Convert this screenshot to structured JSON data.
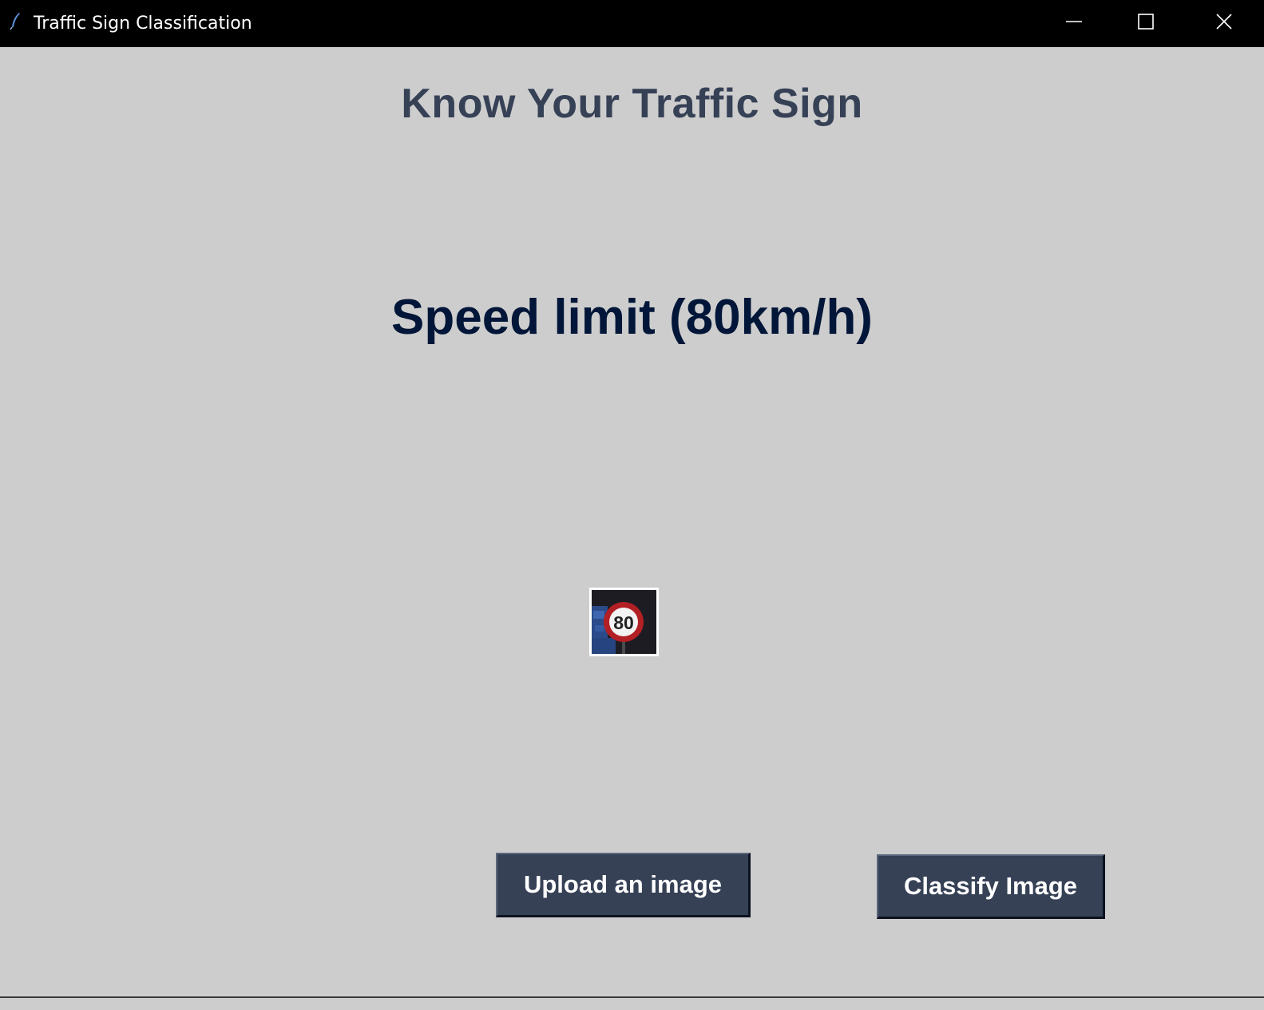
{
  "window": {
    "title": "Traffic Sign Classification",
    "icon": "feather-icon",
    "controls": {
      "minimize_icon": "minimize-icon",
      "maximize_icon": "maximize-icon",
      "close_icon": "close-icon"
    }
  },
  "main": {
    "heading": "Know Your Traffic Sign",
    "result_label": "Speed limit (80km/h)",
    "uploaded_image": {
      "sign_text": "80"
    }
  },
  "buttons": {
    "upload_label": "Upload an image",
    "classify_label": "Classify Image"
  },
  "colors": {
    "background": "#cdcdcd",
    "heading_color": "#364156",
    "result_color": "#011638",
    "button_bg": "#364156",
    "button_text": "#ffffff",
    "titlebar_bg": "#000000"
  }
}
